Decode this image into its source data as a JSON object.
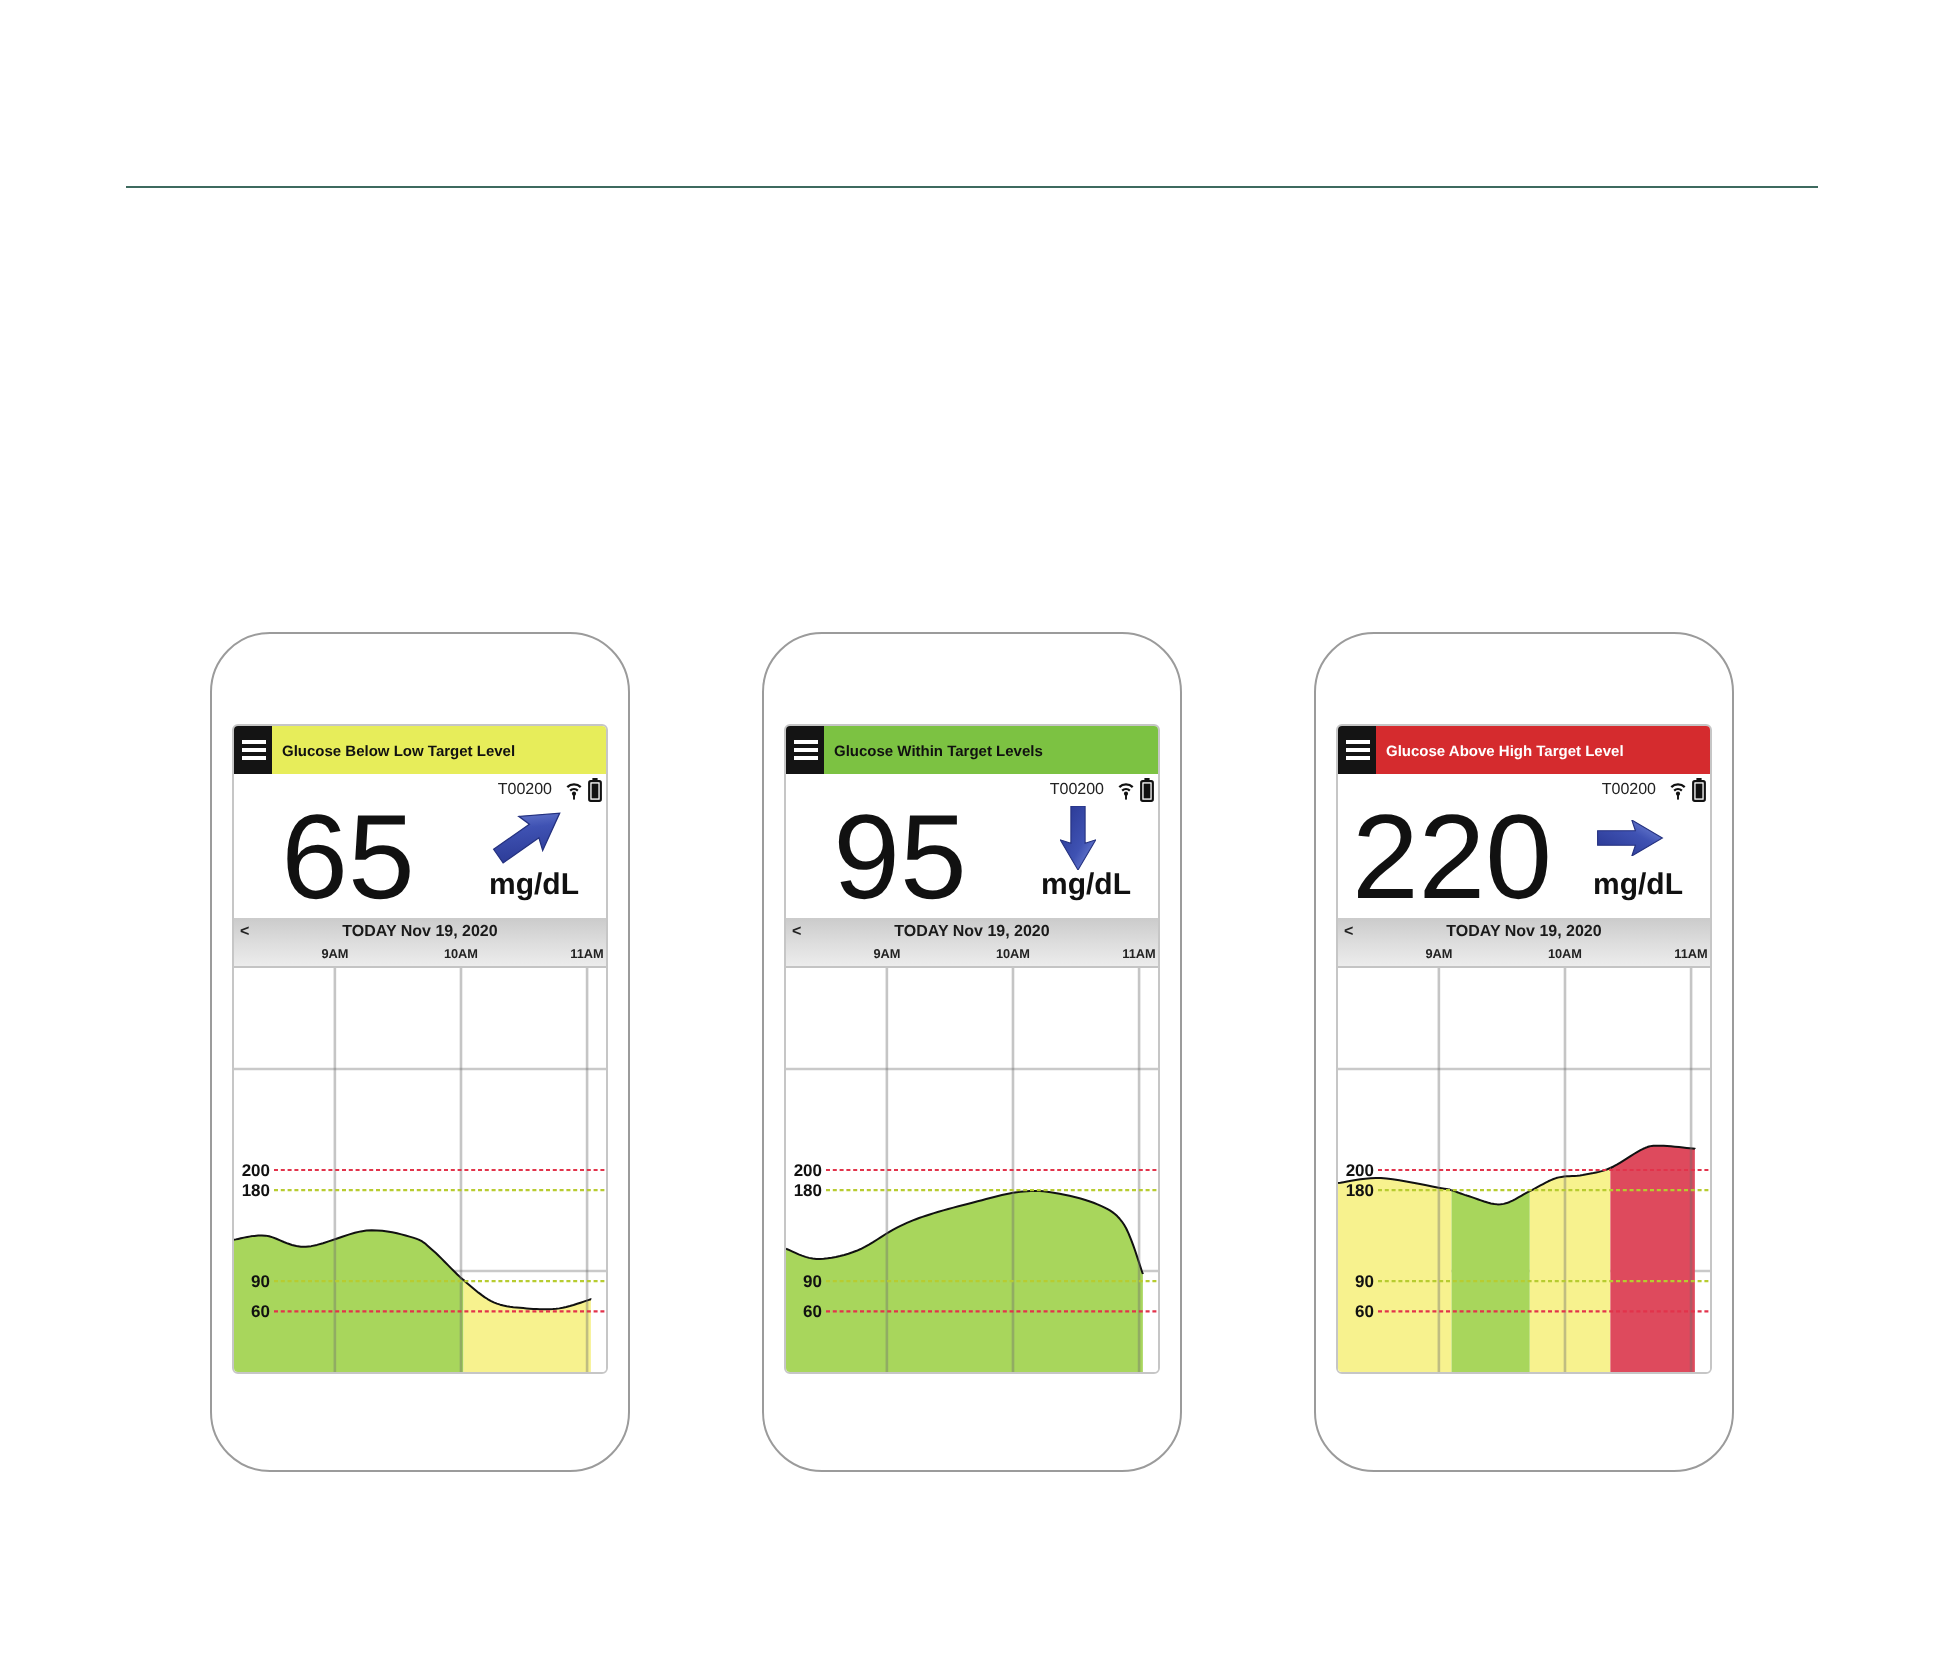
{
  "phones": [
    {
      "status": {
        "label": "Glucose Below Low Target Level",
        "color": "#e7ed5a"
      },
      "sensor_id": "T00200",
      "reading": "65",
      "trend": {
        "kind": "up_right"
      },
      "unit": "mg/dL",
      "date_bar": {
        "back": "<",
        "date": "TODAY Nov 19, 2020"
      },
      "chart_data": {
        "type": "area",
        "x": [
          8.2,
          8.45,
          8.77,
          9.25,
          9.62,
          9.78,
          10.02,
          10.26,
          10.52,
          10.78,
          11.03
        ],
        "series": [
          {
            "color": "#a8d65c",
            "values": [
              131,
              135,
              124,
              140,
              133,
              120,
              91,
              null,
              null,
              null,
              null
            ]
          },
          {
            "color": "#f7f28e",
            "values": [
              null,
              null,
              null,
              null,
              null,
              null,
              91,
              69,
              63,
              63,
              72
            ]
          }
        ],
        "xlim": [
          8.2,
          11.15
        ],
        "ylim": [
          0,
          400
        ],
        "xticks": [
          {
            "value": 9,
            "label": "9AM"
          },
          {
            "value": 10,
            "label": "10AM"
          },
          {
            "value": 11,
            "label": "11AM"
          }
        ],
        "yticks": [
          60,
          90,
          180,
          200
        ],
        "grid": true,
        "ref_lines": [
          {
            "axis": "y",
            "value": 300,
            "color": "#c9c9c9"
          },
          {
            "axis": "y",
            "value": 200,
            "color": "#e2334b"
          },
          {
            "axis": "y",
            "value": 180,
            "color": "#b7cc30"
          },
          {
            "axis": "y",
            "value": 100,
            "color": "#c9c9c9"
          },
          {
            "axis": "y",
            "value": 90,
            "color": "#b7cc30"
          },
          {
            "axis": "y",
            "value": 60,
            "color": "#e2334b"
          }
        ]
      }
    },
    {
      "status": {
        "label": "Glucose Within Target Levels",
        "color": "#7cc242"
      },
      "sensor_id": "T00200",
      "reading": "95",
      "trend": {
        "kind": "down"
      },
      "unit": "mg/dL",
      "date_bar": {
        "back": "<",
        "date": "TODAY Nov 19, 2020"
      },
      "chart_data": {
        "type": "area",
        "x": [
          8.2,
          8.44,
          8.76,
          9.08,
          9.34,
          9.72,
          10.03,
          10.3,
          10.67,
          10.88,
          11.03
        ],
        "series": [
          {
            "color": "#a8d65c",
            "values": [
              122,
              112,
              120,
              143,
              156,
              169,
              178,
              178,
              166,
              146,
              97
            ]
          }
        ],
        "xlim": [
          8.2,
          11.15
        ],
        "ylim": [
          0,
          400
        ],
        "xticks": [
          {
            "value": 9,
            "label": "9AM"
          },
          {
            "value": 10,
            "label": "10AM"
          },
          {
            "value": 11,
            "label": "11AM"
          }
        ],
        "yticks": [
          60,
          90,
          180,
          200
        ],
        "grid": true,
        "ref_lines": [
          {
            "axis": "y",
            "value": 300,
            "color": "#c9c9c9"
          },
          {
            "axis": "y",
            "value": 200,
            "color": "#e2334b"
          },
          {
            "axis": "y",
            "value": 180,
            "color": "#b7cc30"
          },
          {
            "axis": "y",
            "value": 100,
            "color": "#c9c9c9"
          },
          {
            "axis": "y",
            "value": 90,
            "color": "#b7cc30"
          },
          {
            "axis": "y",
            "value": 60,
            "color": "#e2334b"
          }
        ]
      }
    },
    {
      "status": {
        "label": "Glucose Above High Target Level",
        "color": "#d52b2e"
      },
      "sensor_id": "T00200",
      "reading": "220",
      "trend": {
        "kind": "right"
      },
      "unit": "mg/dL",
      "date_bar": {
        "back": "<",
        "date": "TODAY Nov 19, 2020"
      },
      "chart_data": {
        "type": "area",
        "x": [
          8.2,
          8.54,
          9.02,
          9.1,
          9.24,
          9.49,
          9.72,
          9.93,
          10.14,
          10.36,
          10.62,
          10.76,
          11.03
        ],
        "series": [
          {
            "color": "#f7f28e",
            "values": [
              187,
              192,
              182,
              180,
              null,
              null,
              179,
              192,
              195,
              202,
              null,
              null,
              null
            ]
          },
          {
            "color": "#a8d65c",
            "values": [
              null,
              null,
              null,
              180,
              174,
              166,
              179,
              null,
              null,
              null,
              null,
              null,
              null
            ]
          },
          {
            "color": "#de4a5d",
            "values": [
              null,
              null,
              null,
              null,
              null,
              null,
              null,
              null,
              null,
              202,
              221,
              224,
              221
            ]
          }
        ],
        "xlim": [
          8.2,
          11.15
        ],
        "ylim": [
          0,
          400
        ],
        "xticks": [
          {
            "value": 9,
            "label": "9AM"
          },
          {
            "value": 10,
            "label": "10AM"
          },
          {
            "value": 11,
            "label": "11AM"
          }
        ],
        "yticks": [
          60,
          90,
          180,
          200
        ],
        "grid": true,
        "ref_lines": [
          {
            "axis": "y",
            "value": 300,
            "color": "#c9c9c9"
          },
          {
            "axis": "y",
            "value": 200,
            "color": "#e2334b"
          },
          {
            "axis": "y",
            "value": 180,
            "color": "#b7cc30"
          },
          {
            "axis": "y",
            "value": 100,
            "color": "#c9c9c9"
          },
          {
            "axis": "y",
            "value": 90,
            "color": "#b7cc30"
          },
          {
            "axis": "y",
            "value": 60,
            "color": "#e2334b"
          }
        ]
      }
    }
  ]
}
